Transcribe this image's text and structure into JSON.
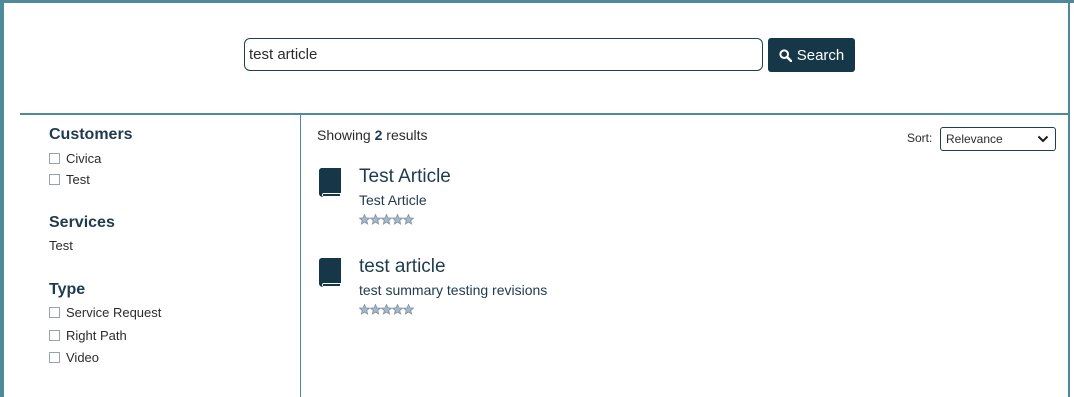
{
  "search": {
    "value": "test article",
    "button_label": "Search",
    "icon": "search-icon"
  },
  "facets": {
    "customers": {
      "title": "Customers",
      "options": [
        "Civica",
        "Test"
      ]
    },
    "services": {
      "title": "Services",
      "items": [
        "Test"
      ]
    },
    "type": {
      "title": "Type",
      "options": [
        "Service Request",
        "Right Path",
        "Video"
      ]
    }
  },
  "results": {
    "showing_prefix": "Showing",
    "count": "2",
    "showing_suffix": "results",
    "sort_label": "Sort:",
    "sort_value": "Relevance",
    "items": [
      {
        "title": "Test Article",
        "summary": "Test Article",
        "rating": 0,
        "max_rating": 5,
        "icon": "book-icon"
      },
      {
        "title": "test article",
        "summary": "test summary testing revisions",
        "rating": 0,
        "max_rating": 5,
        "icon": "book-icon"
      }
    ]
  },
  "colors": {
    "frame": "#4f8a9a",
    "primary": "#163747",
    "text": "#1f3a4d",
    "star": "#7a8fa8"
  }
}
